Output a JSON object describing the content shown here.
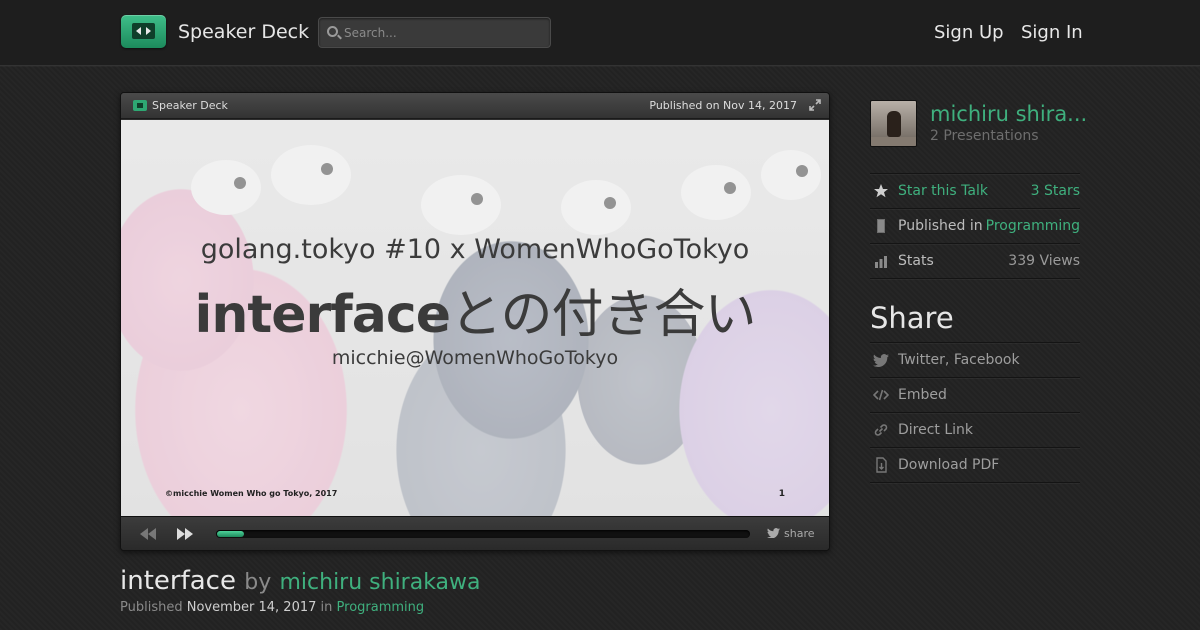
{
  "header": {
    "brand": "Speaker Deck",
    "search_placeholder": "Search...",
    "sign_up": "Sign Up",
    "sign_in": "Sign In"
  },
  "player": {
    "brand": "Speaker Deck",
    "published_on": "Published on Nov 14, 2017",
    "progress_percent": 5,
    "share_label": "share"
  },
  "slide": {
    "subtitle": "golang.tokyo #10 x WomenWhoGoTokyo",
    "title_en": "interface",
    "title_jp": "との付き合い",
    "author": "micchie@WomenWhoGoTokyo",
    "copyright": "©micchie Women Who go Tokyo, 2017",
    "number": "1"
  },
  "talk": {
    "title": "interface",
    "by": "by",
    "author": "michiru shirakawa",
    "published_label": "Published",
    "date": "November 14, 2017",
    "in_label": "in",
    "category": "Programming"
  },
  "sidebar": {
    "author_name": "michiru shira...",
    "presentations": "2 Presentations",
    "star_label": "Star this Talk",
    "stars": "3 Stars",
    "published_in_label": "Published in",
    "published_in_value": "Programming",
    "stats_label": "Stats",
    "views": "339 Views",
    "share_heading": "Share",
    "share_items": [
      "Twitter, Facebook",
      "Embed",
      "Direct Link",
      "Download PDF"
    ]
  },
  "colors": {
    "accent": "#3fb07e",
    "background": "#232323"
  }
}
